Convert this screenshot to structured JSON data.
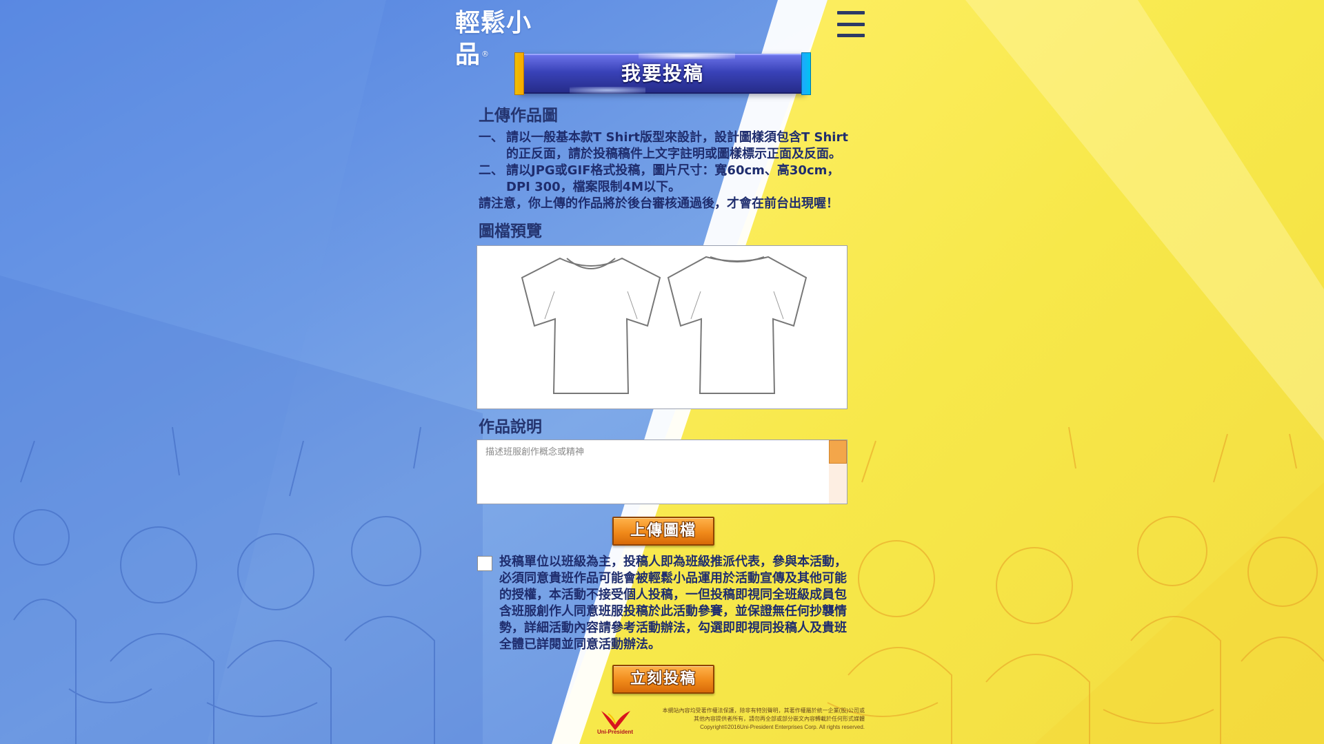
{
  "header": {
    "logo_text": "輕鬆小品",
    "logo_mark": "®"
  },
  "banner": {
    "label": "我要投稿"
  },
  "upload_section": {
    "title": "上傳作品圖",
    "rules": [
      {
        "num": "一、",
        "text": "請以一般基本款T Shirt版型來設計，設計圖樣須包含T Shirt的正反面，請於投稿稿件上文字註明或圖樣標示正面及反面。"
      },
      {
        "num": "二、",
        "text": "請以JPG或GIF格式投稿，圖片尺寸：寬60cm、高30cm，DPI 300，檔案限制4M以下。"
      }
    ],
    "notice": "請注意，你上傳的作品將於後台審核通過後，才會在前台出現喔！"
  },
  "preview_section": {
    "title": "圖檔預覽"
  },
  "description_section": {
    "title": "作品說明",
    "placeholder": "描述班服創作概念或精神",
    "value": ""
  },
  "buttons": {
    "upload_label": "上傳圖檔",
    "submit_label": "立刻投稿"
  },
  "agreement": {
    "checked": false,
    "text": "投稿單位以班級為主，投稿人即為班級推派代表，參與本活動，必須同意貴班作品可能會被輕鬆小品運用於活動宣傳及其他可能的授權，本活動不接受個人投稿，一但投稿即視同全班級成員包含班服創作人同意班服投稿於此活動參賽，並保證無任何抄襲情勢，詳細活動內容請參考活動辦法，勾選即即視同投稿人及貴班全體已詳閱並同意活動辦法。"
  },
  "footer": {
    "brand": "Uni-President",
    "copyright_lines": [
      "本網站內容均受著作權法保護，除非有特別聲明，其著作權屬於統一企業(股)公司或",
      "其他內容提供者所有，請勿再全部或部分嵌文內容轉載於任何形式媒體",
      "Copyright©2016Uni-President Enterprises Corp. All rights reserved."
    ]
  },
  "colors": {
    "bg_blue": "#5b8fe0",
    "bg_yellow": "#f7ea4a",
    "text_navy": "#1f2d6e",
    "button_orange": "#f08a1a",
    "banner_blue": "#3942b8"
  }
}
